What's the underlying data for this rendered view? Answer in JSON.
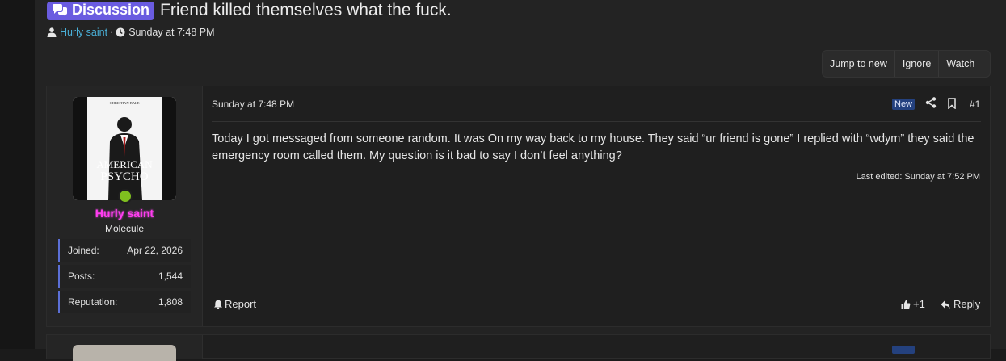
{
  "thread": {
    "prefix": "Discussion",
    "title": "Friend killed themselves what the fuck.",
    "author": "Hurly saint",
    "separator": "·",
    "date": "Sunday at 7:48 PM"
  },
  "actions": {
    "jump_to_new": "Jump to new",
    "ignore": "Ignore",
    "watch": "Watch"
  },
  "post": {
    "date": "Sunday at 7:48 PM",
    "new_badge": "New",
    "number": "#1",
    "body": "Today I got messaged from someone random. It was On my way back to my house. They said “ur friend is gone” I replied with “wdym” they said the emergency room called them. My question is it bad to say I don’t feel anything?",
    "last_edited": "Last edited: Sunday at 7:52 PM",
    "report": "Report",
    "like_count": "+1",
    "reply": "Reply"
  },
  "user": {
    "name": "Hurly saint",
    "title": "Molecule",
    "avatar": {
      "top_text": "CHRISTIAN BALE",
      "title_line1": "AMERICAN",
      "title_line2": "PSYCHO"
    },
    "stats": [
      {
        "label": "Joined:",
        "value": "Apr 22, 2026"
      },
      {
        "label": "Posts:",
        "value": "1,544"
      },
      {
        "label": "Reputation:",
        "value": "1,808"
      }
    ]
  },
  "colors": {
    "prefix": "#6a5ce0",
    "author_link": "#4ab0d8",
    "username": "#ff3cf0",
    "online": "#7fbf1f",
    "new_badge": "#24417e",
    "stat_border": "#5b6fd6"
  }
}
